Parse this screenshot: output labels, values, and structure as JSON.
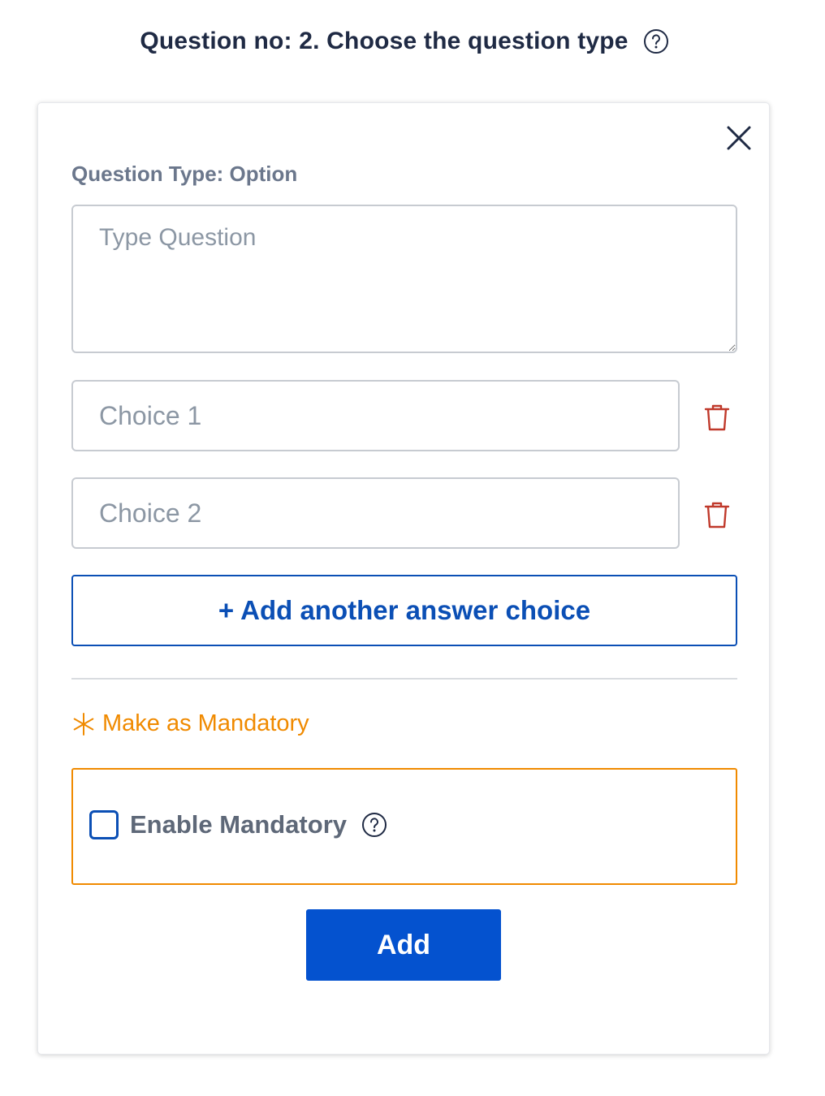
{
  "header": {
    "title": "Question no: 2. Choose the question type",
    "help_icon": "question-circle"
  },
  "card": {
    "close_icon": "close-x",
    "question_type_label": "Question Type: Option",
    "question_placeholder": "Type Question",
    "choices": [
      {
        "placeholder": "Choice 1",
        "delete_icon": "trash"
      },
      {
        "placeholder": "Choice 2",
        "delete_icon": "trash"
      }
    ],
    "add_choice_label": "+ Add another answer choice",
    "mandatory": {
      "heading": "Make as Mandatory",
      "heading_icon": "asterisk",
      "checkbox_label": "Enable Mandatory",
      "checked": false,
      "help_icon": "question-circle"
    },
    "submit_label": "Add"
  },
  "colors": {
    "primary": "#0452cf",
    "accent_orange": "#f08a00",
    "danger": "#c0392b",
    "title_text": "#1f2a44",
    "muted_text": "#6b778c"
  }
}
